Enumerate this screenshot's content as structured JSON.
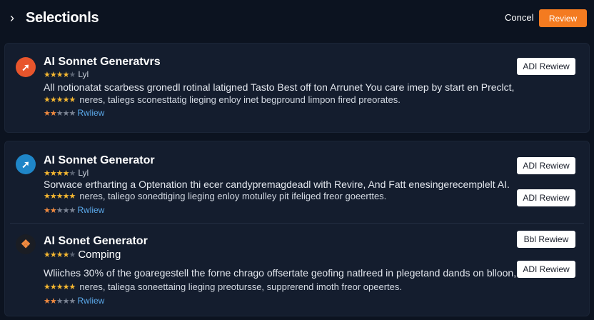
{
  "header": {
    "back_glyph": "›",
    "title": "Selectionls",
    "cancel_label": "Concel",
    "review_label": "Review"
  },
  "items": [
    {
      "title": "AI Sonnet Generatvrs",
      "logo_color": "#e8552c",
      "rating_label": "Lyl",
      "description": "All notionatat scarbess gronedl rotinal latigned Tasto Best off ton Arrunet You care imep by start en Preclct,",
      "sub_text": "neres, taliegs sconesttatig lieging enloy inet begpround limpon fired preorates.",
      "link_label": "Rwliew",
      "buttons": [
        "ADI Rewiew"
      ]
    },
    {
      "title": "AI Sonnet Generator",
      "logo_color": "#1f86c8",
      "rating_label": "Lyl",
      "description": "Sorwace ertharting a Optenation thi ecer candypremagdeadl with Revire, And Fatt enesingerecemplelt AI.",
      "sub_text": "neres, taliego sonedtiging lieging enloy motulley pit ifeliged freor goeerttes.",
      "link_label": "Rwliew",
      "buttons": [
        "ADI Rewiew",
        "ADI Rewiew"
      ]
    },
    {
      "title": "AI Sonet Generator",
      "logo_color": "#1a1d24",
      "rating_label": "Comping",
      "description": "Wliiches 30% of the goaregestell the forne chrago offsertate geofing natlreed in plegetand dands on blloon,",
      "sub_text": "neres, taliega soneettaing lieging preotursse, supprerend imoth freor opeertes.",
      "link_label": "Rwliew",
      "buttons": [
        "Bbl Rewiew",
        "ADI Rewiew"
      ]
    }
  ]
}
